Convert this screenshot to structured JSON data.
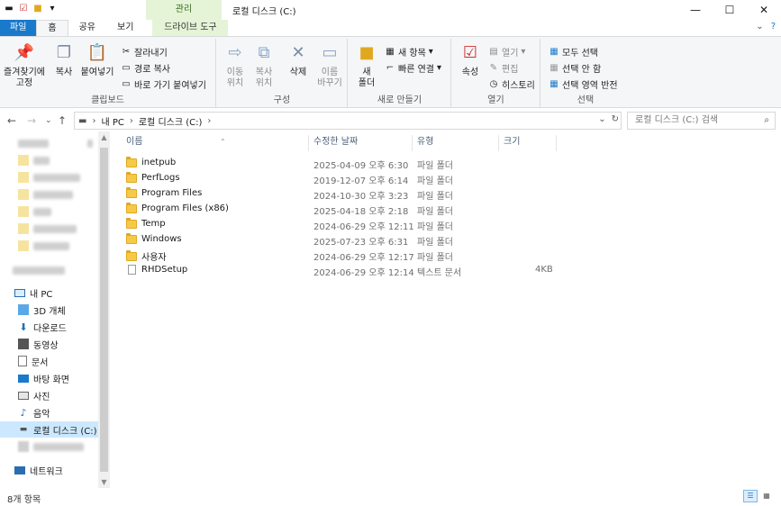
{
  "window": {
    "title": "로컬 디스크 (C:)",
    "manage_tab": "관리",
    "controls": {
      "minimize": "—",
      "maximize": "☐",
      "close": "✕"
    }
  },
  "tabs": [
    {
      "label": "파일"
    },
    {
      "label": "홈"
    },
    {
      "label": "공유"
    },
    {
      "label": "보기"
    },
    {
      "label": "드라이브 도구"
    }
  ],
  "ribbon": {
    "clipboard": {
      "label": "클립보드",
      "pin": "즐겨찾기에\n고정",
      "copy": "복사",
      "paste": "붙여넣기",
      "cut": "잘라내기",
      "copy_path": "경로 복사",
      "paste_shortcut": "바로 가기 붙여넣기"
    },
    "organize": {
      "label": "구성",
      "move_to": "이동\n위치",
      "copy_to": "복사\n위치",
      "delete": "삭제",
      "rename": "이름\n바꾸기"
    },
    "new": {
      "label": "새로 만들기",
      "new_folder": "새\n폴더",
      "new_item": "새 항목",
      "easy_access": "빠른 연결"
    },
    "open": {
      "label": "열기",
      "properties": "속성",
      "open": "열기",
      "edit": "편집",
      "history": "히스토리"
    },
    "select": {
      "label": "선택",
      "select_all": "모두 선택",
      "select_none": "선택 안 함",
      "invert": "선택 영역 반전"
    }
  },
  "address": {
    "path": [
      "내 PC",
      "로컬 디스크 (C:)"
    ],
    "search_placeholder": "로컬 디스크 (C:) 검색"
  },
  "sidebar": {
    "this_pc": "내 PC",
    "items": [
      {
        "label": "3D 개체",
        "icon": "3d-objects-icon"
      },
      {
        "label": "다운로드",
        "icon": "download-icon"
      },
      {
        "label": "동영상",
        "icon": "video-icon"
      },
      {
        "label": "문서",
        "icon": "document-icon"
      },
      {
        "label": "바탕 화면",
        "icon": "desktop-icon"
      },
      {
        "label": "사진",
        "icon": "pictures-icon"
      },
      {
        "label": "음악",
        "icon": "music-icon"
      },
      {
        "label": "로컬 디스크 (C:)",
        "icon": "drive-icon"
      }
    ],
    "network": "네트워크"
  },
  "columns": {
    "name": "이름",
    "date": "수정한 날짜",
    "type": "유형",
    "size": "크기"
  },
  "files": [
    {
      "name": "inetpub",
      "date": "2025-04-09 오후 6:30",
      "type": "파일 폴더",
      "size": "",
      "kind": "folder"
    },
    {
      "name": "PerfLogs",
      "date": "2019-12-07 오후 6:14",
      "type": "파일 폴더",
      "size": "",
      "kind": "folder"
    },
    {
      "name": "Program Files",
      "date": "2024-10-30 오후 3:23",
      "type": "파일 폴더",
      "size": "",
      "kind": "folder"
    },
    {
      "name": "Program Files (x86)",
      "date": "2025-04-18 오후 2:18",
      "type": "파일 폴더",
      "size": "",
      "kind": "folder"
    },
    {
      "name": "Temp",
      "date": "2024-06-29 오후 12:11",
      "type": "파일 폴더",
      "size": "",
      "kind": "folder"
    },
    {
      "name": "Windows",
      "date": "2025-07-23 오후 6:31",
      "type": "파일 폴더",
      "size": "",
      "kind": "folder"
    },
    {
      "name": "사용자",
      "date": "2024-06-29 오후 12:17",
      "type": "파일 폴더",
      "size": "",
      "kind": "folder"
    },
    {
      "name": "RHDSetup",
      "date": "2024-06-29 오후 12:14",
      "type": "텍스트 문서",
      "size": "4KB",
      "kind": "file"
    }
  ],
  "status": {
    "count": "8개 항목"
  },
  "colors": {
    "file_tab": "#1979ca",
    "manage_tab": "#e5f4d6",
    "selected": "#cce8ff",
    "folder": "#f7c948"
  }
}
